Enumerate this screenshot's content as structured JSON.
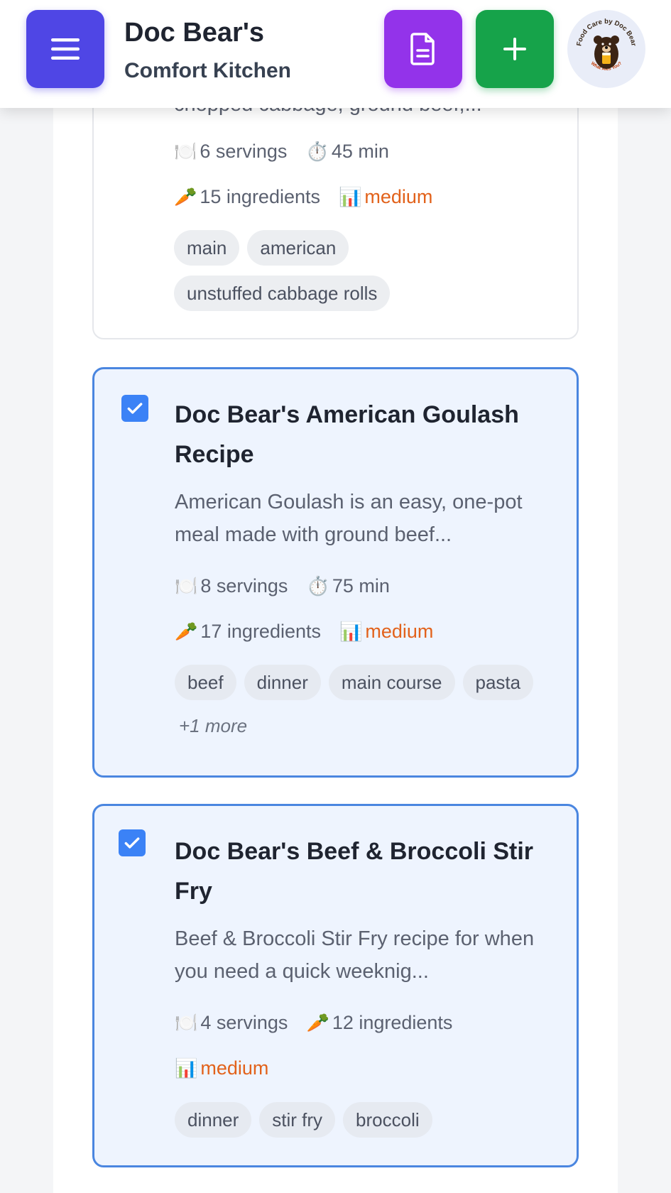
{
  "header": {
    "title": "Doc Bear's",
    "subtitle": "Comfort Kitchen",
    "menu_icon": "hamburger-icon",
    "doc_icon": "document-icon",
    "add_icon": "plus-icon",
    "logo": {
      "top_text": "Food Care by Doc Bear",
      "bottom_text": "What Ales You?"
    },
    "colors": {
      "menu": "#4f46e5",
      "doc": "#9333ea",
      "add": "#16a34a"
    }
  },
  "recipes": [
    {
      "partial_desc": "chopped cabbage, ground beef,...",
      "servings": "6 servings",
      "time": "45 min",
      "ingredients": "15 ingredients",
      "difficulty": "medium",
      "tags": [
        "main",
        "american",
        "unstuffed cabbage rolls"
      ],
      "selected": false
    },
    {
      "title": "Doc Bear's American Goulash Recipe",
      "description": "American Goulash is an easy, one-pot meal made with ground beef...",
      "servings": "8 servings",
      "time": "75 min",
      "ingredients": "17 ingredients",
      "difficulty": "medium",
      "tags": [
        "beef",
        "dinner",
        "main course",
        "pasta"
      ],
      "more": "+1 more",
      "selected": true
    },
    {
      "title": "Doc Bear's Beef & Broccoli Stir Fry",
      "description": "Beef & Broccoli Stir Fry recipe for when you need a quick weeknig...",
      "servings": "4 servings",
      "ingredients": "12 ingredients",
      "difficulty": "medium",
      "tags": [
        "dinner",
        "stir fry",
        "broccoli"
      ],
      "selected": true
    }
  ]
}
